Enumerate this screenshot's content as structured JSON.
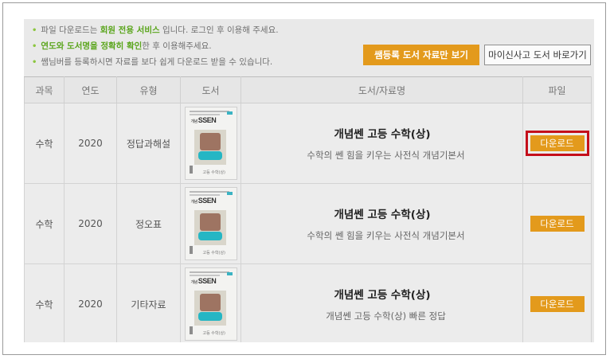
{
  "notices": [
    {
      "parts": [
        {
          "text": "파일 다운로드는 ",
          "hl": false
        },
        {
          "text": "회원 전용 서비스",
          "hl": true
        },
        {
          "text": " 입니다. 로그인 후 이용해 주세요.",
          "hl": false
        }
      ]
    },
    {
      "parts": [
        {
          "text": "연도와 도서명을 정확히 확인",
          "hl": true
        },
        {
          "text": "한 후 이용해주세요.",
          "hl": false
        }
      ]
    },
    {
      "parts": [
        {
          "text": "쌤님버를 등록하시면 자료를 보다 쉽게 다운로드 받을 수 있습니다.",
          "hl": false
        }
      ]
    }
  ],
  "buttons": {
    "registered_only": "쌤등록 도서 자료만 보기",
    "my_books": "마이신사고 도서 바로가기"
  },
  "table": {
    "headers": [
      "과목",
      "연도",
      "유형",
      "도서",
      "도서/자료명",
      "파일"
    ],
    "rows": [
      {
        "subject": "수학",
        "year": "2020",
        "type": "정답과해설",
        "title": "개념쎈 고등 수학(상)",
        "desc": "수학의 쎈 힘을 키우는 사전식 개념기본서",
        "file": "다운로드",
        "highlighted": true
      },
      {
        "subject": "수학",
        "year": "2020",
        "type": "정오표",
        "title": "개념쎈 고등 수학(상)",
        "desc": "수학의 쎈 힘을 키우는 사전식 개념기본서",
        "file": "다운로드",
        "highlighted": false
      },
      {
        "subject": "수학",
        "year": "2020",
        "type": "기타자료",
        "title": "개념쎈 고등 수학(상)",
        "desc": "개념쎈 고등 수학(상) 빠른 정답",
        "file": "다운로드",
        "highlighted": false
      }
    ]
  },
  "cover": {
    "brand": "개념SSEN",
    "brand_prefix": "개념",
    "brand_main": "SSEN",
    "foot": "고등 수학(상)"
  },
  "colors": {
    "accent": "#e39a1c",
    "highlight_border": "#c40f1b",
    "notice_highlight": "#5aa51c",
    "bullet": "#8cc63f"
  }
}
